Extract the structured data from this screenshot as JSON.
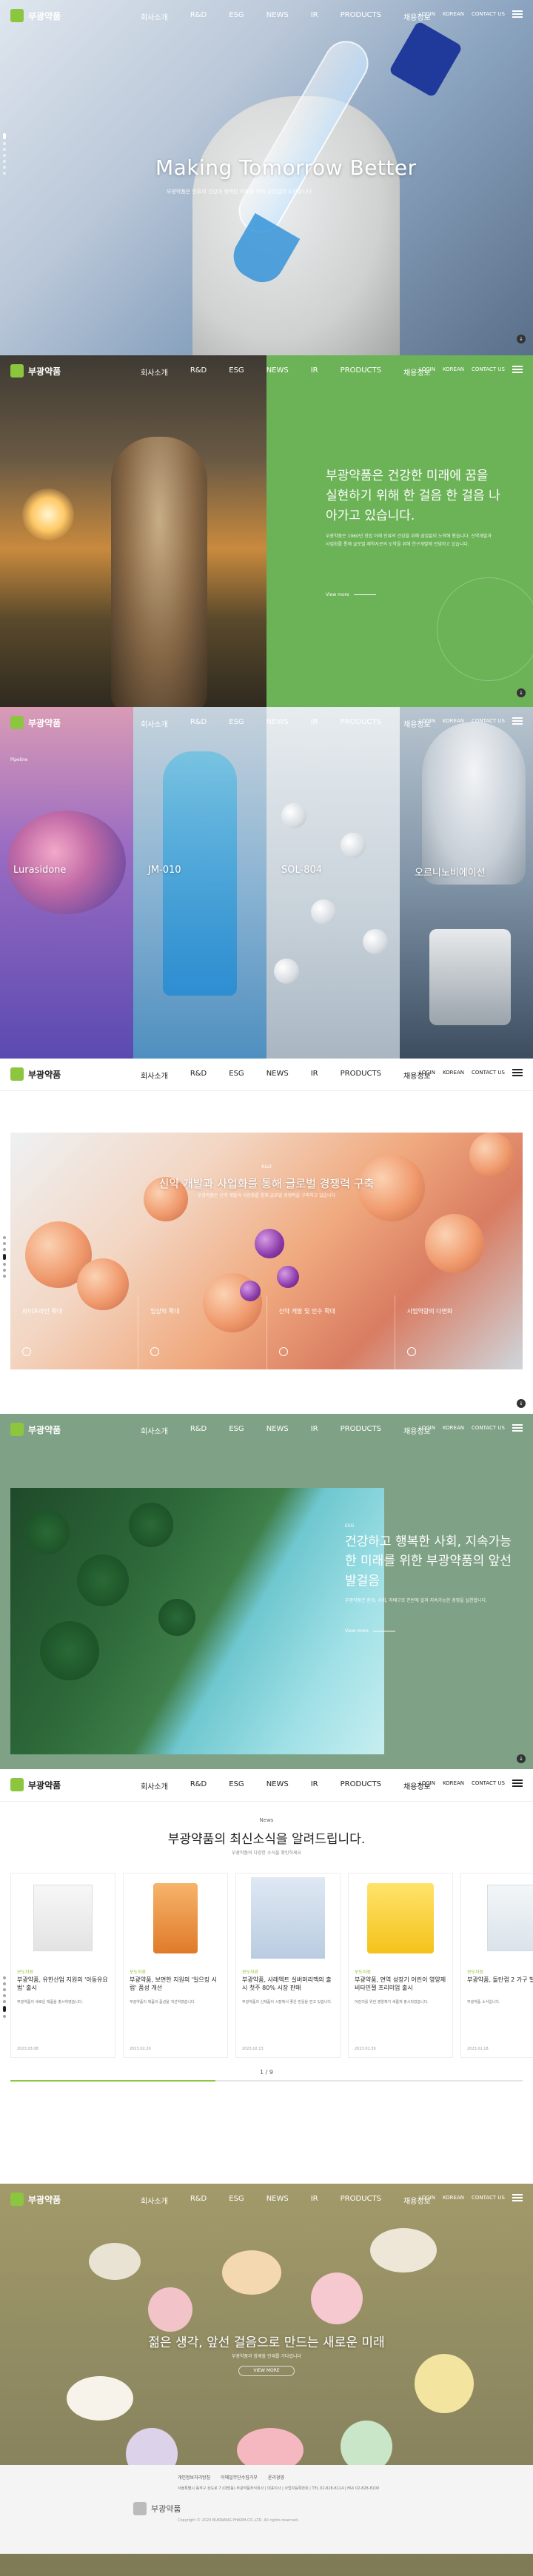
{
  "brand": {
    "name": "부광약품",
    "accent": "#8cc63f",
    "green_panel": "#6cb257"
  },
  "nav": {
    "items": [
      "회사소개",
      "R&D",
      "ESG",
      "NEWS",
      "IR",
      "PRODUCTS",
      "채용정보"
    ],
    "util": [
      "LOGIN",
      "KOREAN",
      "CONTACT US"
    ]
  },
  "hero": {
    "title": "Making Tomorrow Better",
    "subtitle": "부광약품은 인류의 건강과 행복한 미래를 위해 끊임없이 도전합니다"
  },
  "vision": {
    "heading": "부광약품은 건강한 미래에 꿈을 실현하기 위해 한 걸음 한 걸음 나아가고 있습니다.",
    "desc": "부광약품은 1960년 창립 이래 인류의 건강을 위해 끊임없이 노력해 왔습니다. 신약개발과 사업화를 통해 글로벌 제약사로의 도약을 위해 연구개발에 전념하고 있습니다.",
    "more": "View more"
  },
  "pipeline": {
    "tag": "Pipeline",
    "items": [
      "Lurasidone",
      "JM-010",
      "SOL-804",
      "오르니노비에이션"
    ]
  },
  "business": {
    "tag": "R&D",
    "title": "신약 개발과 사업화를 통해 글로벌 경쟁력 구축",
    "subtitle": "부광약품은 신약 개발과 사업화를 통해 글로벌 경쟁력을 구축하고 있습니다",
    "cells": [
      "파이프라인 확대",
      "임상의 확대",
      "신약 개발 및 인수 확대",
      "사업역량의 다변화"
    ]
  },
  "esg": {
    "tag": "ESG",
    "title": "건강하고 행복한 사회, 지속가능한 미래를 위한 부광약품의 앞선 발걸음",
    "desc": "부광약품은 환경, 사회, 지배구조 전반에 걸쳐 지속가능한 경영을 실천합니다.",
    "more": "View more"
  },
  "news": {
    "tag": "News",
    "title": "부광약품의 최신소식을 알려드립니다.",
    "subtitle": "부광약품의 다양한 소식을 확인하세요",
    "count": "1 / 9",
    "cards": [
      {
        "cat": "보도자료",
        "title": "부광약품, 유한산업 지원의 '아동유요법' 출시",
        "desc": "부광약품이 새로운 제품을 출시하였습니다.",
        "date": "2023.03.08"
      },
      {
        "cat": "보도자료",
        "title": "부광약품, 보면한 지원의 '일으킹 시럽' 품성 개선",
        "desc": "부광약품이 제품의 품성을 개선하였습니다.",
        "date": "2023.02.20"
      },
      {
        "cat": "보도자료",
        "title": "부광약품, 사레엑트 실버머리맥의 출시 첫주 80% 시장 판매",
        "desc": "부광약품의 신제품이 시장에서 좋은 반응을 얻고 있습니다.",
        "date": "2023.02.13"
      },
      {
        "cat": "보도자료",
        "title": "부광약품, 면역 성장기 어린이 영양제 비타민젤 프리미엄 출시",
        "desc": "어린이를 위한 영양제가 새롭게 출시되었습니다.",
        "date": "2023.01.30"
      },
      {
        "cat": "보도자료",
        "title": "부광약품, 돌탄캡 2 가구 빌딩",
        "desc": "부광약품 소식입니다.",
        "date": "2023.01.18"
      }
    ]
  },
  "pills": {
    "title": "젊은 생각, 앞선 걸음으로 만드는 새로운 미래",
    "subtitle": "부광약품과 함께할 인재를 기다립니다",
    "button": "VIEW MORE"
  },
  "footer": {
    "links": [
      "개인정보처리방침",
      "이메일무단수집거부",
      "윤리경영"
    ],
    "info": "서울특별시 동작구 상도로 7 (대방동) 부광약품주식회사 | 대표이사 | 사업자등록번호 | TEL 02-828-8114 | FAX 02-828-8100",
    "copy": "Copyright © 2023 BUKWANG PHARM.CO.,LTD. All rights reserved."
  }
}
